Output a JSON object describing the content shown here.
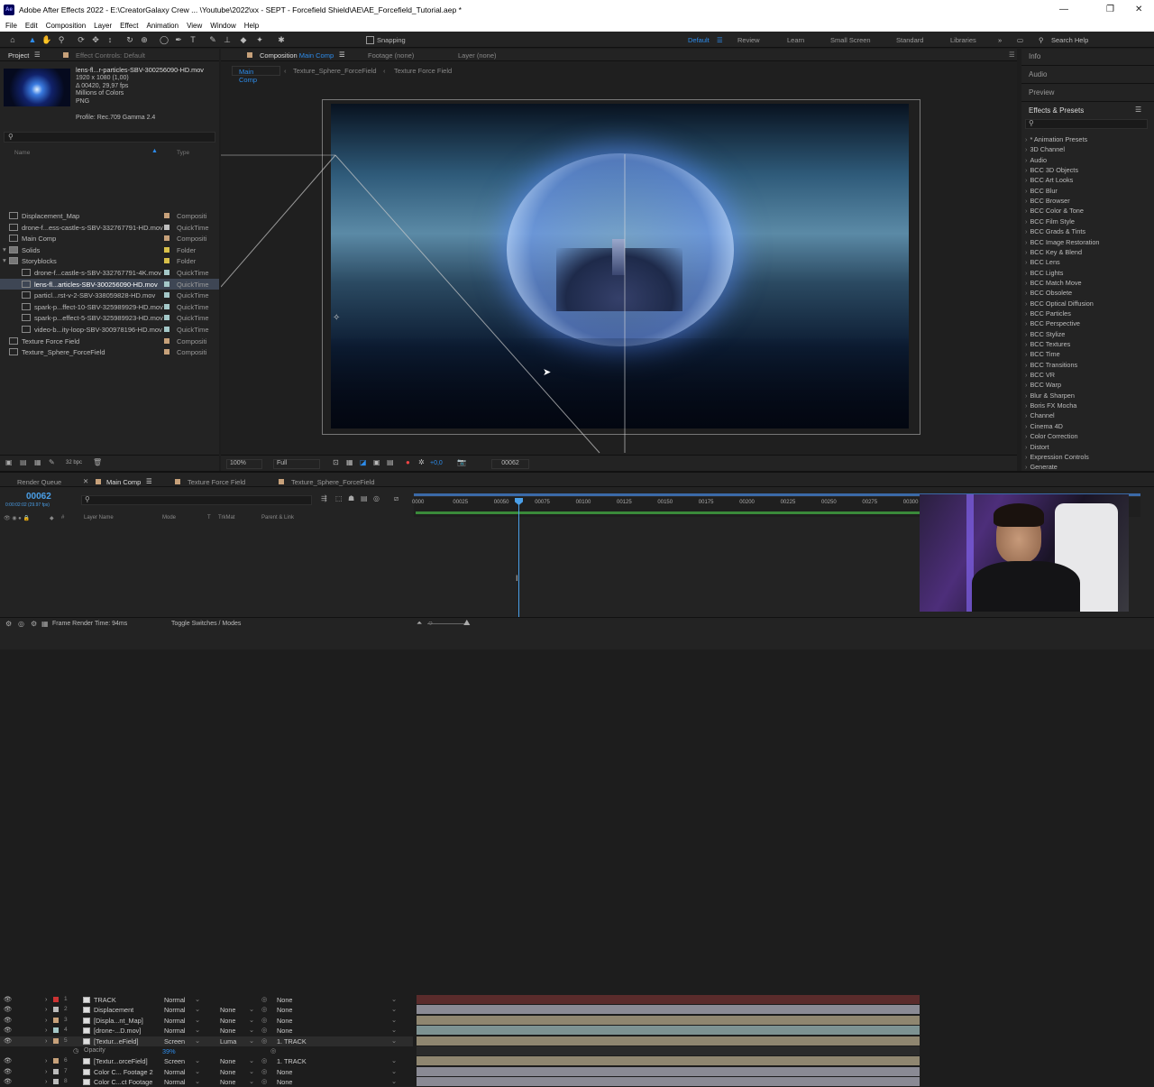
{
  "app": {
    "title": "Adobe After Effects 2022 - E:\\CreatorGalaxy Crew ... \\Youtube\\2022\\xx - SEPT - Forcefield Shield\\AE\\AE_Forcefield_Tutorial.aep *",
    "logo": "Ae"
  },
  "menu": [
    "File",
    "Edit",
    "Composition",
    "Layer",
    "Effect",
    "Animation",
    "View",
    "Window",
    "Help"
  ],
  "toolbar": {
    "snapping": "Snapping",
    "workspaces": [
      "Default",
      "Review",
      "Learn",
      "Small Screen",
      "Standard",
      "Libraries"
    ],
    "search_placeholder": "Search Help",
    "active_workspace": "Default"
  },
  "project": {
    "tab": "Project",
    "effect_controls": "Effect Controls: Default",
    "file": "lens-fl...r-particles-SBV-300256090-HD.mov",
    "details": [
      "1920 x 1080 (1,00)",
      "Δ 00420, 29,97 fps",
      "Millions of Colors",
      "PNG"
    ],
    "profile": "Profile: Rec.709 Gamma 2.4",
    "col_name": "Name",
    "col_type": "Type",
    "items": [
      {
        "name": "Displacement_Map",
        "type": "Compositi",
        "color": "#c7a17a",
        "indent": 0
      },
      {
        "name": "drone-f...ess-castle-s-SBV-332767791-HD.mov",
        "type": "QuickTime",
        "color": "#bfbfbf",
        "indent": 0
      },
      {
        "name": "Main Comp",
        "type": "Compositi",
        "color": "#c7a17a",
        "indent": 0
      },
      {
        "name": "Solids",
        "type": "Folder",
        "color": "#d8c04a",
        "indent": 0
      },
      {
        "name": "Storyblocks",
        "type": "Folder",
        "color": "#d8c04a",
        "indent": 0
      },
      {
        "name": "drone-f...castle-s-SBV-332767791-4K.mov",
        "type": "QuickTime",
        "color": "#a4c8c8",
        "indent": 1
      },
      {
        "name": "lens-fl...articles-SBV-300256090-HD.mov",
        "type": "QuickTime",
        "color": "#a4c8c8",
        "indent": 1,
        "selected": true
      },
      {
        "name": "particl...rst-v-2-SBV-338059828-HD.mov",
        "type": "QuickTime",
        "color": "#a4c8c8",
        "indent": 1
      },
      {
        "name": "spark-p...ffect-10-SBV-325989929-HD.mov",
        "type": "QuickTime",
        "color": "#a4c8c8",
        "indent": 1
      },
      {
        "name": "spark-p...effect-5-SBV-325989923-HD.mov",
        "type": "QuickTime",
        "color": "#a4c8c8",
        "indent": 1
      },
      {
        "name": "video-b...ity-loop-SBV-300978196-HD.mov",
        "type": "QuickTime",
        "color": "#a4c8c8",
        "indent": 1
      },
      {
        "name": "Texture Force Field",
        "type": "Compositi",
        "color": "#c7a17a",
        "indent": 0
      },
      {
        "name": "Texture_Sphere_ForceField",
        "type": "Compositi",
        "color": "#c7a17a",
        "indent": 0
      }
    ],
    "bpc": "32 bpc"
  },
  "viewer": {
    "tab": "Composition",
    "comp_name": "Main Comp",
    "footage": "Footage (none)",
    "layer": "Layer (none)",
    "breadcrumbs": [
      "Main Comp",
      "Texture_Sphere_ForceField",
      "Texture Force Field"
    ],
    "zoom": "100%",
    "quality": "Full",
    "exposure": "+0,0",
    "timecode": "00062"
  },
  "right": {
    "panels": [
      "Info",
      "Audio",
      "Preview"
    ],
    "effects_title": "Effects & Presets",
    "effects": [
      "* Animation Presets",
      "3D Channel",
      "Audio",
      "BCC 3D Objects",
      "BCC Art Looks",
      "BCC Blur",
      "BCC Browser",
      "BCC Color & Tone",
      "BCC Film Style",
      "BCC Grads & Tints",
      "BCC Image Restoration",
      "BCC Key & Blend",
      "BCC Lens",
      "BCC Lights",
      "BCC Match Move",
      "BCC Obsolete",
      "BCC Optical Diffusion",
      "BCC Particles",
      "BCC Perspective",
      "BCC Stylize",
      "BCC Textures",
      "BCC Time",
      "BCC Transitions",
      "BCC VR",
      "BCC Warp",
      "Blur & Sharpen",
      "Boris FX Mocha",
      "Channel",
      "Cinema 4D",
      "Color Correction",
      "Distort",
      "Expression Controls",
      "Generate"
    ]
  },
  "timeline": {
    "tabs": [
      "Render Queue",
      "Main Comp",
      "Texture Force Field",
      "Texture_Sphere_ForceField"
    ],
    "timecode": "00062",
    "fps": "0:00:02:02 (29.97 fps)",
    "headers": {
      "layer_name": "Layer Name",
      "mode": "Mode",
      "t": "T",
      "trkmat": "TrkMat",
      "parent": "Parent & Link"
    },
    "ruler": [
      "0000",
      "00025",
      "00050",
      "00075",
      "00100",
      "00125",
      "00150",
      "00175",
      "00200",
      "00225",
      "00250",
      "00275",
      "00300"
    ],
    "layers": [
      {
        "num": "1",
        "name": "TRACK",
        "mode": "Normal",
        "trkmat": "",
        "parent": "None",
        "color": "#c33",
        "bar": "#5a2b2b"
      },
      {
        "num": "2",
        "name": "Displacement",
        "mode": "Normal",
        "trkmat": "None",
        "parent": "None",
        "color": "#bbb",
        "bar": "#8a8a94"
      },
      {
        "num": "3",
        "name": "[Displa...nt_Map]",
        "mode": "Normal",
        "trkmat": "None",
        "parent": "None",
        "color": "#c7a17a",
        "bar": "#8f8670"
      },
      {
        "num": "4",
        "name": "[drone-...D.mov]",
        "mode": "Normal",
        "trkmat": "None",
        "parent": "None",
        "color": "#a4c8c8",
        "bar": "#7d9292"
      },
      {
        "num": "5",
        "name": "[Textur...eField]",
        "mode": "Screen",
        "trkmat": "Luma",
        "parent": "1. TRACK",
        "color": "#c7a17a",
        "bar": "#8f8670"
      },
      {
        "num": "",
        "name": "Opacity",
        "mode": "39%",
        "trkmat": "",
        "parent": "",
        "color": "",
        "bar": "#2b2b2b",
        "sub": true
      },
      {
        "num": "6",
        "name": "[Textur...orceField]",
        "mode": "Screen",
        "trkmat": "None",
        "parent": "1. TRACK",
        "color": "#c7a17a",
        "bar": "#8f8670"
      },
      {
        "num": "7",
        "name": "Color C... Footage 2",
        "mode": "Normal",
        "trkmat": "None",
        "parent": "None",
        "color": "#bbb",
        "bar": "#8a8a94"
      },
      {
        "num": "8",
        "name": "Color C...ct Footage",
        "mode": "Normal",
        "trkmat": "None",
        "parent": "None",
        "color": "#bbb",
        "bar": "#8a8a94"
      }
    ],
    "render_time": "Frame Render Time: 94ms",
    "toggle": "Toggle Switches / Modes"
  },
  "colors": {
    "accent": "#2d8ceb",
    "timecode": "#4a9fe8"
  }
}
